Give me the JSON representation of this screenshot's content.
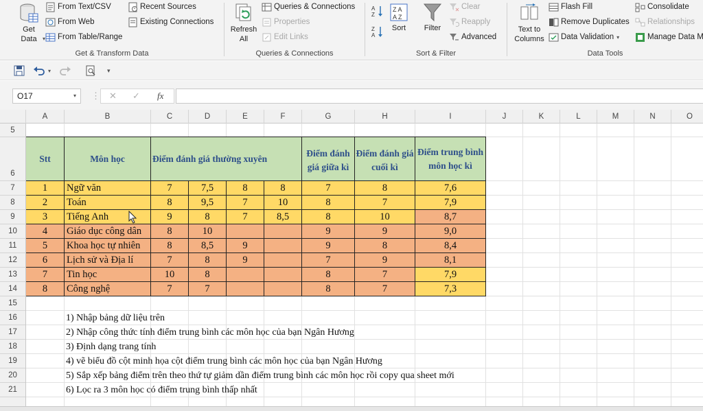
{
  "ribbon": {
    "get_transform": {
      "get_data_label": "Get\nData",
      "from_text_csv": "From Text/CSV",
      "from_web": "From Web",
      "from_table_range": "From Table/Range",
      "recent_sources": "Recent Sources",
      "existing_connections": "Existing Connections",
      "group_label": "Get & Transform Data"
    },
    "queries": {
      "refresh_all_label": "Refresh\nAll",
      "queries_connections": "Queries & Connections",
      "properties": "Properties",
      "edit_links": "Edit Links",
      "group_label": "Queries & Connections"
    },
    "sort_filter": {
      "sort_label": "Sort",
      "filter_label": "Filter",
      "clear": "Clear",
      "reapply": "Reapply",
      "advanced": "Advanced",
      "group_label": "Sort & Filter"
    },
    "data_tools": {
      "text_to_columns_label": "Text to\nColumns",
      "flash_fill": "Flash Fill",
      "remove_duplicates": "Remove Duplicates",
      "data_validation": "Data Validation",
      "consolidate": "Consolidate",
      "relationships": "Relationships",
      "manage_data_model": "Manage Data M",
      "group_label": "Data Tools"
    }
  },
  "formula_bar": {
    "name_box": "O17",
    "fx_label": "fx",
    "formula": ""
  },
  "columns": [
    "A",
    "B",
    "C",
    "D",
    "E",
    "F",
    "G",
    "H",
    "I",
    "J",
    "K",
    "L",
    "M",
    "N",
    "O"
  ],
  "rows": [
    "5",
    "6",
    "7",
    "8",
    "9",
    "10",
    "11",
    "12",
    "13",
    "14",
    "15",
    "16",
    "17",
    "18",
    "19",
    "20",
    "21"
  ],
  "table": {
    "headers": {
      "stt": "Stt",
      "subject": "Môn học",
      "regular": "Điểm đánh giá thường xuyên",
      "midterm": "Điểm đánh giá giữa kì",
      "final": "Điểm đánh giá cuối kì",
      "average": "Điểm trung bình môn học kì"
    },
    "rows": [
      {
        "stt": "1",
        "subject": "Ngữ văn",
        "c": "7",
        "d": "7,5",
        "e": "8",
        "f": "8",
        "g": "7",
        "h": "8",
        "i": "7,6",
        "avg_color": "yellow"
      },
      {
        "stt": "2",
        "subject": "Toán",
        "c": "8",
        "d": "9,5",
        "e": "7",
        "f": "10",
        "g": "8",
        "h": "7",
        "i": "7,9",
        "avg_color": "yellow"
      },
      {
        "stt": "3",
        "subject": "Tiếng Anh",
        "c": "9",
        "d": "8",
        "e": "7",
        "f": "8,5",
        "g": "8",
        "h": "10",
        "i": "8,7",
        "avg_color": "orange"
      },
      {
        "stt": "4",
        "subject": "Giáo dục công dân",
        "c": "8",
        "d": "10",
        "e": "",
        "f": "",
        "g": "9",
        "h": "9",
        "i": "9,0",
        "avg_color": "orange"
      },
      {
        "stt": "5",
        "subject": "Khoa học tự  nhiên",
        "c": "8",
        "d": "8,5",
        "e": "9",
        "f": "",
        "g": "9",
        "h": "8",
        "i": "8,4",
        "avg_color": "orange"
      },
      {
        "stt": "6",
        "subject": "Lịch sử và Địa lí",
        "c": "7",
        "d": "8",
        "e": "9",
        "f": "",
        "g": "7",
        "h": "9",
        "i": "8,1",
        "avg_color": "orange"
      },
      {
        "stt": "7",
        "subject": "Tin học",
        "c": "10",
        "d": "8",
        "e": "",
        "f": "",
        "g": "8",
        "h": "7",
        "i": "7,9",
        "avg_color": "yellow"
      },
      {
        "stt": "8",
        "subject": "Công nghệ",
        "c": "7",
        "d": "7",
        "e": "",
        "f": "",
        "g": "8",
        "h": "7",
        "i": "7,3",
        "avg_color": "yellow"
      }
    ]
  },
  "notes": [
    "1) Nhập bảng dữ liệu trên",
    "2) Nhập công thức tính điểm trung bình các môn học của bạn Ngân Hương",
    "3) Định dạng trang tính",
    "4) vẽ biểu đồ cột minh họa cột điểm trung bình các môn học của bạn Ngân Hương",
    "5)  Sắp xếp bảng điểm trên theo thứ tự giảm dần điểm trung bình các môn học rồi copy qua sheet mới",
    "6)  Lọc ra 3 môn học có điểm trung bình thấp nhất"
  ],
  "colors": {
    "header_fill": "#c6e0b4",
    "header_text": "#2e4f8a",
    "yellow_fill": "#ffd966",
    "orange_fill": "#f4b183"
  }
}
